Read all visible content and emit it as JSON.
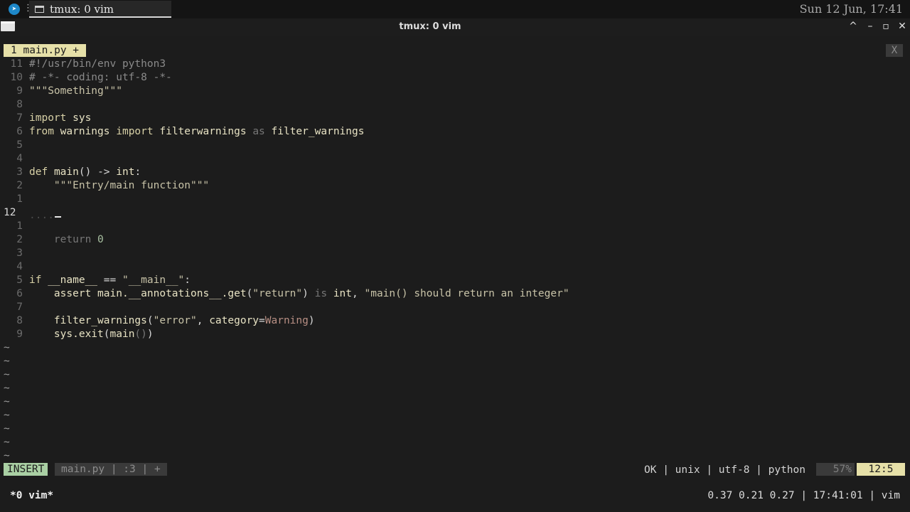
{
  "taskbar": {
    "ws_glyph": "⋮≡",
    "task_title": "tmux: 0 vim",
    "clock": "Sun 12 Jun, 17:41"
  },
  "window": {
    "title": "tmux: 0 vim",
    "min": "–",
    "max": "▫",
    "close": "✕",
    "maximize_glyph": "^"
  },
  "vim": {
    "tab_label": "1 main.py +",
    "tab_close": "X",
    "lines": [
      {
        "num": "11",
        "html": "<span class=\"cm\">#!/usr/bin/env python3</span>"
      },
      {
        "num": "10",
        "html": "<span class=\"cm\"># -*- coding: utf-8 -*-</span>"
      },
      {
        "num": "9",
        "html": "<span class=\"str\">\"\"\"Something\"\"\"</span>"
      },
      {
        "num": "8",
        "html": ""
      },
      {
        "num": "7",
        "html": "<span class=\"kw\">import</span> <span class=\"nm\">sys</span>"
      },
      {
        "num": "6",
        "html": "<span class=\"kw\">from</span> <span class=\"nm\">warnings</span> <span class=\"kw\">import</span> <span class=\"nm\">filterwarnings</span> <span class=\"dim\">as</span> <span class=\"nm\">filter_warnings</span>"
      },
      {
        "num": "5",
        "html": ""
      },
      {
        "num": "4",
        "html": ""
      },
      {
        "num": "3",
        "html": "<span class=\"kw\">def</span> <span class=\"nm\">main</span><span class=\"op\">()</span> <span class=\"op\">-&gt;</span> <span class=\"nm\">int</span><span class=\"op\">:</span>"
      },
      {
        "num": "2",
        "html": "    <span class=\"str\">\"\"\"Entry/main function\"\"\"</span>"
      },
      {
        "num": "1",
        "html": ""
      },
      {
        "num": "12",
        "cur": true,
        "html": ""
      },
      {
        "num": "1",
        "html": ""
      },
      {
        "num": "2",
        "html": "    <span class=\"dim\">return</span> <span class=\"num\">0</span>"
      },
      {
        "num": "3",
        "html": ""
      },
      {
        "num": "4",
        "html": ""
      },
      {
        "num": "5",
        "html": "<span class=\"kw\">if</span> <span class=\"nm\">__name__</span> <span class=\"op\">==</span> <span class=\"str\">\"__main__\"</span><span class=\"op\">:</span>"
      },
      {
        "num": "6",
        "html": "    <span class=\"nm\">assert</span> <span class=\"nm\">main.__annotations__.get</span><span class=\"op\">(</span><span class=\"str\">\"return\"</span><span class=\"op\">)</span> <span class=\"dim\">is</span> <span class=\"nm\">int</span><span class=\"op\">,</span> <span class=\"str\">\"main() should return an integer\"</span>"
      },
      {
        "num": "7",
        "html": ""
      },
      {
        "num": "8",
        "html": "    <span class=\"nm\">filter_warnings</span><span class=\"op\">(</span><span class=\"str\">\"error\"</span><span class=\"op\">,</span> <span class=\"nm\">category</span><span class=\"op\">=</span><span class=\"warn\">Warning</span><span class=\"op\">)</span>"
      },
      {
        "num": "9",
        "html": "    <span class=\"nm\">sys.exit</span><span class=\"op\">(</span><span class=\"nm\">main</span><span class=\"dim\">()</span><span class=\"op\">)</span>"
      }
    ],
    "tilde_count": 9,
    "tilde": "~",
    "mode": "INSERT",
    "fileinfo": "main.py | :3 | +",
    "status_right": "OK | unix | utf-8 | python",
    "percent": "57%",
    "position": "12:5"
  },
  "tmux": {
    "window": "*0 vim*",
    "right": "0.37 0.21 0.27 | 17:41:01 | vim"
  }
}
